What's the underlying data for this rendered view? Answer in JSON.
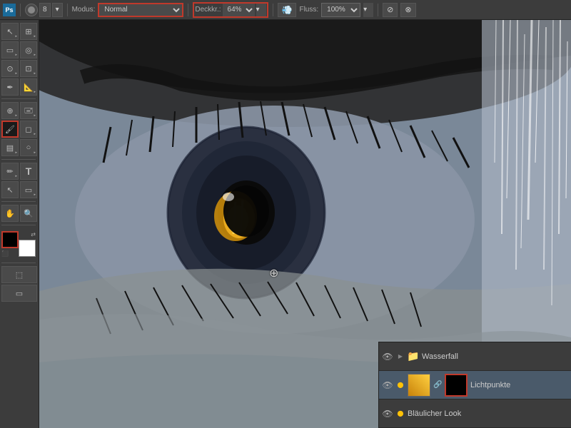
{
  "toolbar": {
    "brush_size": "8",
    "modus_label": "Modus:",
    "modus_value": "Normal",
    "opacity_label": "Deckkr.:",
    "opacity_value": "64%",
    "flow_label": "Fluss:",
    "flow_value": "100%"
  },
  "tools": [
    {
      "id": "marquee-rect",
      "icon": "▭",
      "label": "Rechteck-Auswahlwerkzeug"
    },
    {
      "id": "marquee-lasso",
      "icon": "⌖",
      "label": "Lasso"
    },
    {
      "id": "crop",
      "icon": "⊡",
      "label": "Zuschneiden"
    },
    {
      "id": "eyedropper",
      "icon": "✒",
      "label": "Pipette"
    },
    {
      "id": "brush",
      "icon": "🖌",
      "label": "Pinsel",
      "selected": true
    },
    {
      "id": "eraser",
      "icon": "◻",
      "label": "Radiergummi"
    },
    {
      "id": "gradient",
      "icon": "▤",
      "label": "Verlauf"
    },
    {
      "id": "pen",
      "icon": "✏",
      "label": "Stift"
    },
    {
      "id": "type",
      "icon": "T",
      "label": "Text"
    },
    {
      "id": "path-select",
      "icon": "↖",
      "label": "Pfadauswahl"
    },
    {
      "id": "shape",
      "icon": "○",
      "label": "Form"
    },
    {
      "id": "hand",
      "icon": "✋",
      "label": "Hand"
    },
    {
      "id": "zoom",
      "icon": "🔍",
      "label": "Zoom"
    }
  ],
  "layers": [
    {
      "id": "wasserfall-folder",
      "name": "Wasserfall",
      "type": "folder",
      "visible": true,
      "expanded": true,
      "indent": false
    },
    {
      "id": "lichtpunkte-layer",
      "name": "Lichtpunkte",
      "type": "layer",
      "visible": true,
      "selected": true,
      "thumb_color": "#e6a817",
      "has_mask": true,
      "indent": true
    },
    {
      "id": "blaeulicher-look-layer",
      "name": "Bläulicher Look",
      "type": "layer",
      "visible": true,
      "selected": false,
      "indent": false
    }
  ],
  "colors": {
    "foreground": "#000000",
    "background": "#ffffff",
    "accent": "#c0392b",
    "folder_color": "#c8821a",
    "layer_selected_bg": "#4a5a6a"
  },
  "cursor": {
    "icon": "⊕"
  }
}
